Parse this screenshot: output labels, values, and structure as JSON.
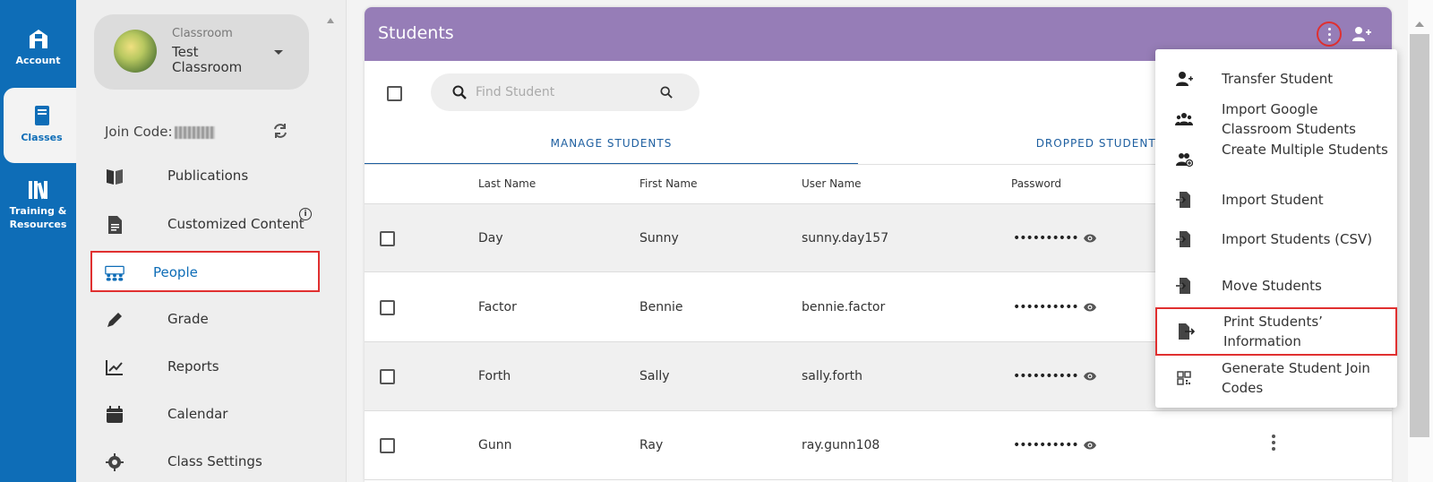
{
  "rail": {
    "items": [
      {
        "label": "Account",
        "icon": "account-icon"
      },
      {
        "label": "Classes",
        "icon": "book-icon"
      },
      {
        "label": "Training &\nResources",
        "icon": "library-icon"
      }
    ]
  },
  "sidebar": {
    "class_subtitle": "Classroom",
    "class_name": "Test Classroom",
    "join_label": "Join Code:",
    "nav": [
      {
        "label": "Publications",
        "icon": "book-open-icon"
      },
      {
        "label": "Customized Content",
        "icon": "document-icon"
      },
      {
        "label": "People",
        "icon": "people-icon"
      },
      {
        "label": "Grade",
        "icon": "pencil-icon"
      },
      {
        "label": "Reports",
        "icon": "chart-icon"
      },
      {
        "label": "Calendar",
        "icon": "calendar-icon"
      },
      {
        "label": "Class Settings",
        "icon": "gear-icon"
      }
    ]
  },
  "main": {
    "title": "Students",
    "search_placeholder": "Find Student",
    "tabs": [
      {
        "label": "MANAGE STUDENTS"
      },
      {
        "label": "DROPPED STUDENTS"
      }
    ],
    "columns": [
      "Last Name",
      "First Name",
      "User Name",
      "Password"
    ],
    "rows": [
      {
        "last": "Day",
        "first": "Sunny",
        "user": "sunny.day157",
        "pwd": "••••••••••"
      },
      {
        "last": "Factor",
        "first": "Bennie",
        "user": "bennie.factor",
        "pwd": "••••••••••"
      },
      {
        "last": "Forth",
        "first": "Sally",
        "user": "sally.forth",
        "pwd": "••••••••••"
      },
      {
        "last": "Gunn",
        "first": "Ray",
        "user": "ray.gunn108",
        "pwd": "••••••••••"
      }
    ]
  },
  "menu": {
    "items": [
      {
        "label": "Transfer Student",
        "icon": "person-add-icon"
      },
      {
        "label": "Import Google Classroom Students",
        "icon": "group-icon"
      },
      {
        "label": "Create Multiple Students",
        "icon": "group-add-icon"
      },
      {
        "label": "Import Student",
        "icon": "import-icon"
      },
      {
        "label": "Import Students (CSV)",
        "icon": "import-icon"
      },
      {
        "label": "Move Students",
        "icon": "import-icon"
      },
      {
        "label": "Print Students’ Information",
        "icon": "print-export-icon"
      },
      {
        "label": "Generate Student Join Codes",
        "icon": "qr-code-icon"
      }
    ]
  },
  "colors": {
    "rail": "#0e6db7",
    "header": "#967db7",
    "highlight": "#e03030",
    "tab_accent": "#1e5fa0"
  }
}
